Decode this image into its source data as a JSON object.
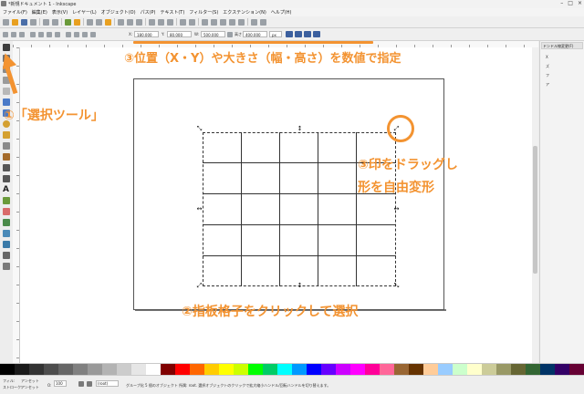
{
  "window": {
    "title": "*新規ドキュメント 1 - Inkscape",
    "controls": [
      "–",
      "□",
      "×"
    ]
  },
  "menu": [
    "ファイル(F)",
    "編集(E)",
    "表示(V)",
    "レイヤー(L)",
    "オブジェクト(O)",
    "パス(P)",
    "テキスト(T)",
    "フィルター(S)",
    "エクステンション(N)",
    "ヘルプ(H)"
  ],
  "controls": {
    "x_label": "X:",
    "x_value": "180.000",
    "y_label": "Y:",
    "y_value": "80.000",
    "w_label": "W:",
    "w_value": "500.000",
    "h_label": "高さ",
    "h_value": "400.000",
    "unit": "px"
  },
  "dock": {
    "tab": "ドンドル線変更(F)",
    "items": [
      "X",
      "ズ",
      "フ",
      "ア"
    ]
  },
  "status": {
    "fill_label": "フィル:",
    "stroke_label": "ストローク:",
    "fill_value": "アンセット",
    "stroke_value": "アンセット",
    "opacity_label": "O:",
    "opacity_value": "100",
    "layer_value": "(root)",
    "message": "グループ化 5 個のオブジェクト 所属: root. 選択オブジェクトのクリックで拡大縮小ハンドル/回転ハンドルを切り替えます。"
  },
  "annotations": {
    "tool": "①「選択ツール」",
    "controls": "③位置（X・Y）や大きさ（幅・高さ）を数値で指定",
    "handle_line1": "③印をドラッグし",
    "handle_line2": "形を自由変形",
    "grid": "②指板格子をクリックして選択"
  },
  "colors": {
    "annotation": "#f39331",
    "palette": [
      "#000000",
      "#1a1a1a",
      "#333333",
      "#4d4d4d",
      "#666666",
      "#808080",
      "#999999",
      "#b3b3b3",
      "#cccccc",
      "#e6e6e6",
      "#ffffff",
      "#800000",
      "#ff0000",
      "#ff6600",
      "#ffcc00",
      "#ffff00",
      "#ccff00",
      "#00ff00",
      "#00cc66",
      "#00ffff",
      "#0099ff",
      "#0000ff",
      "#6600ff",
      "#cc00ff",
      "#ff00ff",
      "#ff0099",
      "#ff6699",
      "#996633",
      "#663300",
      "#ffcc99",
      "#99ccff",
      "#ccffcc",
      "#ffffcc",
      "#cccc99",
      "#999966",
      "#666633",
      "#336633",
      "#003366",
      "#330066",
      "#660033"
    ]
  }
}
